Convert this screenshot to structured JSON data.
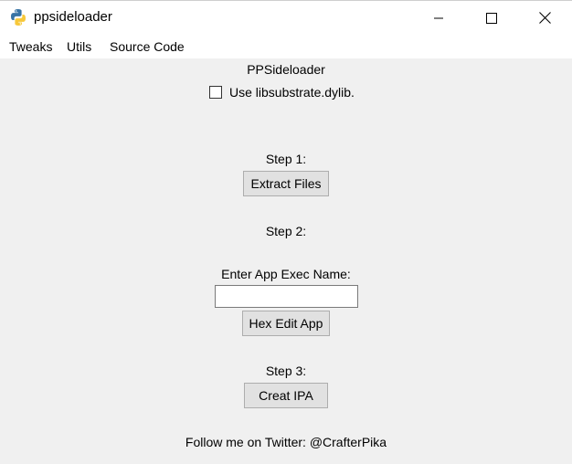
{
  "window": {
    "title": "ppsideloader",
    "icon": "python-icon"
  },
  "menu": {
    "items": [
      "Tweaks",
      "Utils",
      "Source Code"
    ]
  },
  "main": {
    "heading": "PPSideloader",
    "checkbox_label": "Use libsubstrate.dylib.",
    "checkbox_checked": false,
    "step1_label": "Step 1:",
    "step1_button": "Extract Files",
    "step2_label": "Step 2:",
    "exec_name_label": "Enter App Exec Name:",
    "exec_name_value": "",
    "step2_button": "Hex Edit App",
    "step3_label": "Step 3:",
    "step3_button": "Creat IPA",
    "footer": "Follow me on Twitter: @CrafterPika"
  }
}
